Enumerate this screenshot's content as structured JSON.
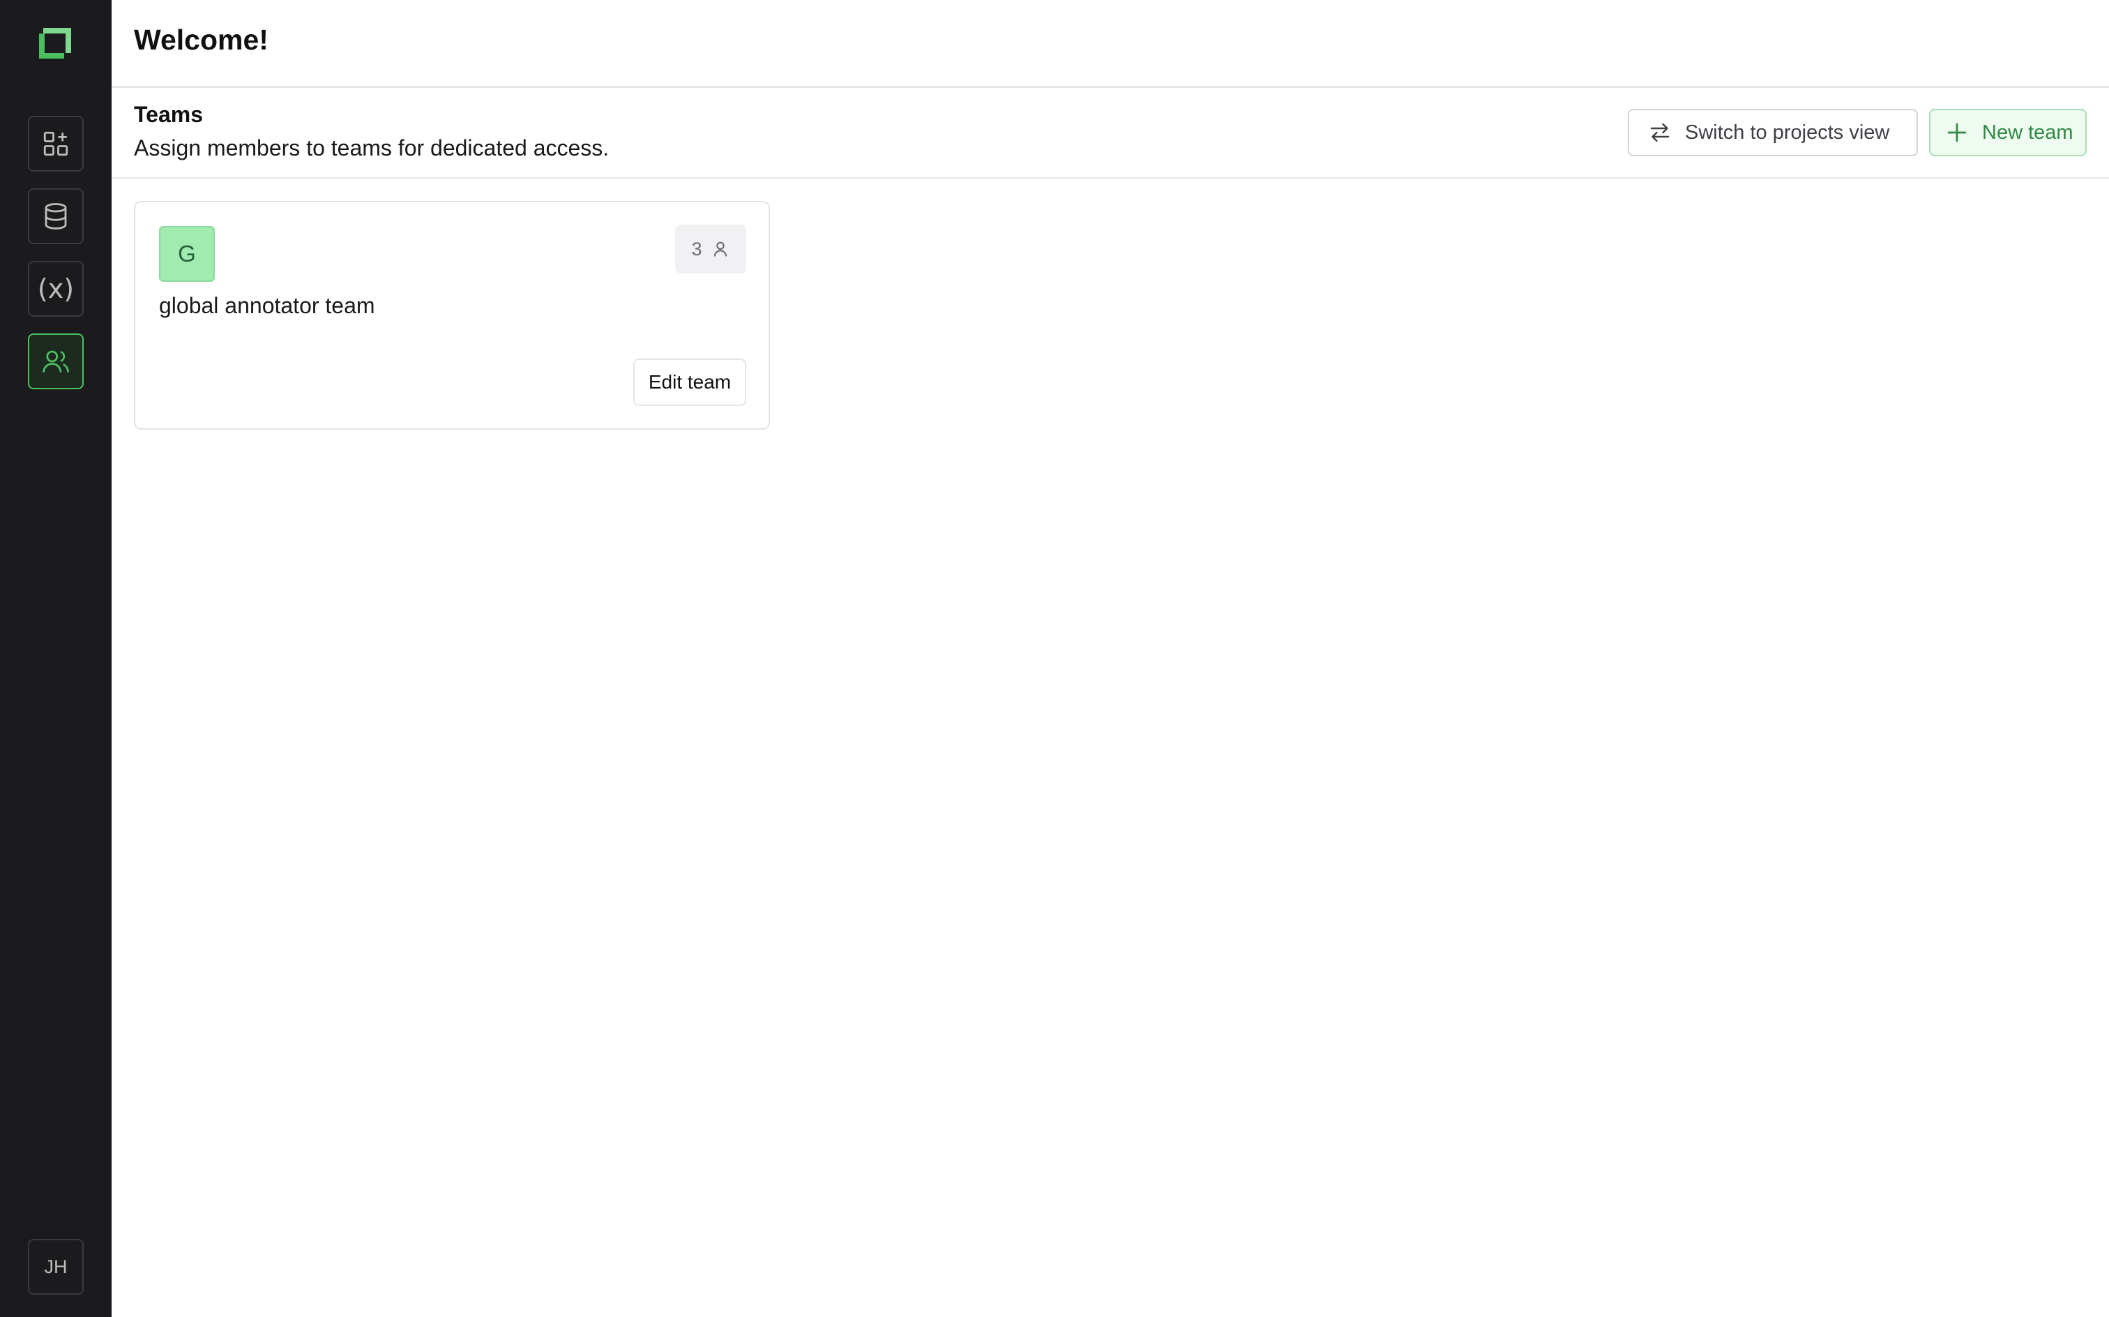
{
  "header": {
    "title": "Welcome!"
  },
  "section": {
    "title": "Teams",
    "subtitle": "Assign members to teams for dedicated access."
  },
  "actions": {
    "switch_label": "Switch to projects view",
    "new_team_label": "New team"
  },
  "sidebar": {
    "items": [
      {
        "name": "apps",
        "icon": "apps-add-icon",
        "active": false
      },
      {
        "name": "datasets",
        "icon": "database-icon",
        "active": false
      },
      {
        "name": "variables",
        "icon": "variable-icon",
        "label": "(x)",
        "active": false
      },
      {
        "name": "teams",
        "icon": "users-icon",
        "active": true
      }
    ],
    "user_initials": "JH"
  },
  "teams": [
    {
      "initial": "G",
      "name": "global annotator team",
      "member_count": "3",
      "edit_label": "Edit team"
    }
  ],
  "colors": {
    "sidebar_bg": "#1b1b1d",
    "accent": "#4bbf60",
    "team_avatar_bg": "#a2ebb0"
  }
}
